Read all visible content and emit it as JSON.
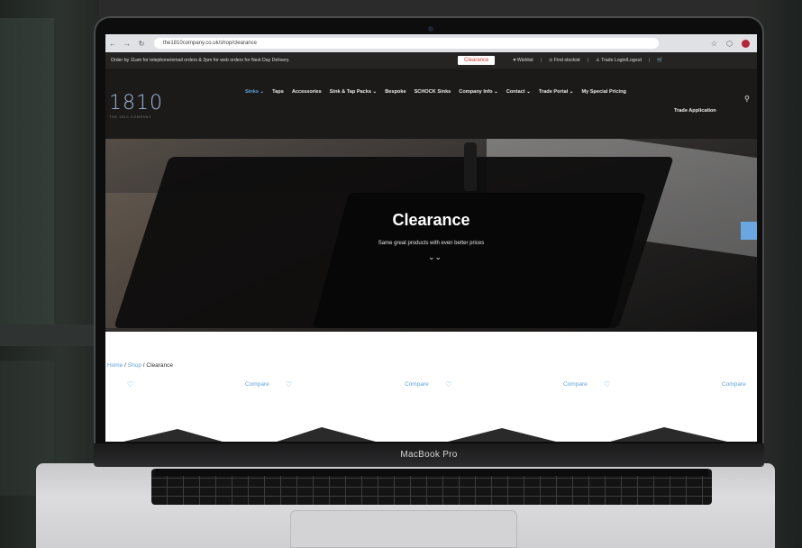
{
  "browser": {
    "url": "the1810company.co.uk/shop/clearance",
    "nav_back": "←",
    "nav_forward": "→",
    "nav_reload": "↻",
    "bookmark_icon": "☆",
    "extension_icon": "⬡"
  },
  "utility_bar": {
    "message": "Order by 11am for telephone/email orders & 2pm for web orders for Next Day Delivery.",
    "clearance_button": "Clearance",
    "wishlist": "♥ Wishlist",
    "find_stockist": "⊙ Find stockist",
    "trade_login": "♙ Trade Login/Logout",
    "separator": "|",
    "cart_icon": "🛒"
  },
  "header": {
    "logo": "1810",
    "logo_sub": "THE 1810 COMPANY",
    "nav": [
      "Sinks ⌄",
      "Taps",
      "Accessories",
      "Sink & Tap Packs ⌄",
      "Bespoke",
      "SCHOCK Sinks",
      "Company Info ⌄",
      "Contact ⌄",
      "Trade Portal ⌄",
      "My Special Pricing"
    ],
    "nav_second_row": "Trade Application",
    "search_icon": "⚲"
  },
  "hero": {
    "title": "Clearance",
    "subtitle": "Same great products with even better prices",
    "scroll_indicator": "⌄⌄"
  },
  "breadcrumb": {
    "home": "Home",
    "shop": "Shop",
    "current": " / Clearance",
    "divider": " / "
  },
  "products": {
    "heart_icon": "♡",
    "compare_label": "Compare"
  },
  "device": {
    "label": "MacBook Pro"
  },
  "colors": {
    "accent": "#5fa4dc",
    "clearance_text": "#d33b2c",
    "header_bg": "#1c1a19"
  }
}
